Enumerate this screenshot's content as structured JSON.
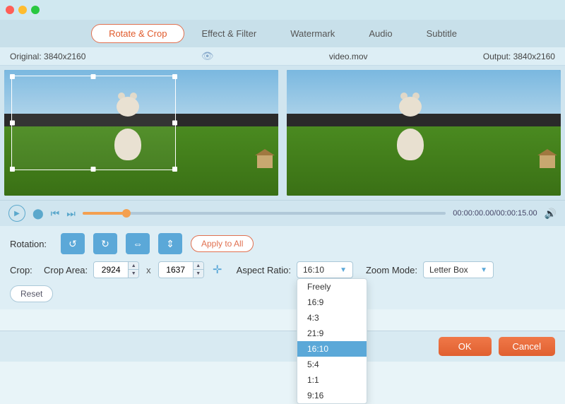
{
  "titleBar": {
    "trafficLights": [
      "red",
      "yellow",
      "green"
    ]
  },
  "tabs": {
    "items": [
      {
        "label": "Rotate & Crop",
        "active": true
      },
      {
        "label": "Effect & Filter",
        "active": false
      },
      {
        "label": "Watermark",
        "active": false
      },
      {
        "label": "Audio",
        "active": false
      },
      {
        "label": "Subtitle",
        "active": false
      }
    ]
  },
  "infoBar": {
    "original": "Original: 3840x2160",
    "filename": "video.mov",
    "output": "Output: 3840x2160"
  },
  "playback": {
    "timeDisplay": "00:00:00.00/00:00:15.00"
  },
  "rotation": {
    "label": "Rotation:",
    "applyToAll": "Apply to All"
  },
  "crop": {
    "label": "Crop:",
    "areaLabel": "Crop Area:",
    "widthValue": "2924",
    "heightValue": "1637",
    "aspectLabel": "Aspect Ratio:",
    "aspectValue": "16:10",
    "zoomLabel": "Zoom Mode:",
    "zoomValue": "Letter Box",
    "resetLabel": "Reset"
  },
  "aspectOptions": [
    {
      "label": "Freely",
      "selected": false
    },
    {
      "label": "16:9",
      "selected": false
    },
    {
      "label": "4:3",
      "selected": false
    },
    {
      "label": "21:9",
      "selected": false
    },
    {
      "label": "16:10",
      "selected": true
    },
    {
      "label": "5:4",
      "selected": false
    },
    {
      "label": "1:1",
      "selected": false
    },
    {
      "label": "9:16",
      "selected": false
    }
  ],
  "bottomBar": {
    "okLabel": "OK",
    "cancelLabel": "Cancel"
  }
}
